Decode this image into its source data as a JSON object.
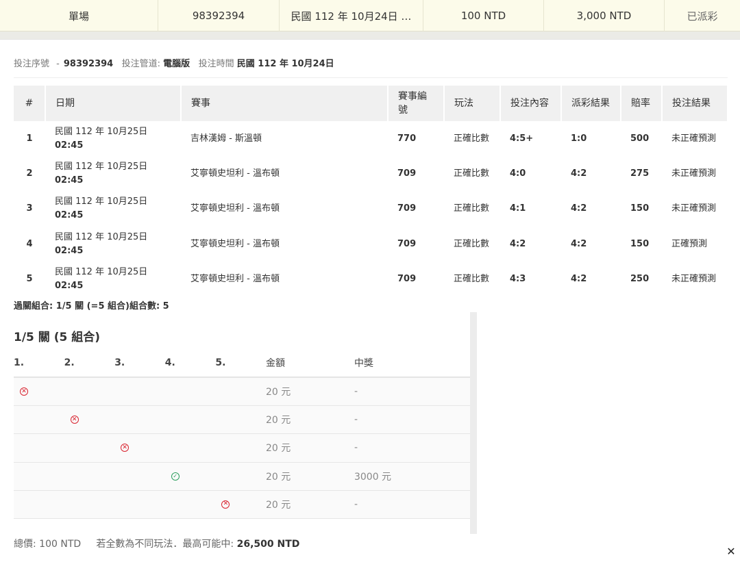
{
  "summary": {
    "type": "單場",
    "bet_no": "98392394",
    "date": "民國 112 年 10月24日 …",
    "stake": "100 NTD",
    "max_win": "3,000 NTD",
    "status": "已派彩"
  },
  "meta": {
    "bet_no_label": "投注序號",
    "bet_no_sep": "-",
    "bet_no": "98392394",
    "channel_label": "投注管道:",
    "channel": "電腦版",
    "time_label": "投注時間",
    "time": "民國 112 年 10月24日"
  },
  "bets": {
    "headers": [
      "#",
      "日期",
      "賽事",
      "賽事編號",
      "玩法",
      "投注內容",
      "派彩結果",
      "賠率",
      "投注結果"
    ],
    "rows": [
      {
        "no": "1",
        "date": "民國 112 年 10月25日",
        "time": "02:45",
        "match": "吉林漢姆 - 斯溫頓",
        "match_no": "770",
        "play": "正確比數",
        "pick": "4:5+",
        "result": "1:0",
        "odds": "500",
        "outcome": "未正確預測"
      },
      {
        "no": "2",
        "date": "民國 112 年 10月25日",
        "time": "02:45",
        "match": "艾寧頓史坦利 - 溫布頓",
        "match_no": "709",
        "play": "正確比數",
        "pick": "4:0",
        "result": "4:2",
        "odds": "275",
        "outcome": "未正確預測"
      },
      {
        "no": "3",
        "date": "民國 112 年 10月25日",
        "time": "02:45",
        "match": "艾寧頓史坦利 - 溫布頓",
        "match_no": "709",
        "play": "正確比數",
        "pick": "4:1",
        "result": "4:2",
        "odds": "150",
        "outcome": "未正確預測"
      },
      {
        "no": "4",
        "date": "民國 112 年 10月25日",
        "time": "02:45",
        "match": "艾寧頓史坦利 - 溫布頓",
        "match_no": "709",
        "play": "正確比數",
        "pick": "4:2",
        "result": "4:2",
        "odds": "150",
        "outcome": "正確預測"
      },
      {
        "no": "5",
        "date": "民國 112 年 10月25日",
        "time": "02:45",
        "match": "艾寧頓史坦利 - 溫布頓",
        "match_no": "709",
        "play": "正確比數",
        "pick": "4:3",
        "result": "4:2",
        "odds": "250",
        "outcome": "未正確預測"
      }
    ]
  },
  "combo_summary": "過關組合: 1/5 關 (=5 組合)組合數: 5",
  "combo": {
    "title": "1/5 關 (5 組合)",
    "headers": [
      "1.",
      "2.",
      "3.",
      "4.",
      "5.",
      "金額",
      "中獎"
    ],
    "rows": [
      {
        "leg": 1,
        "icon": "cross-circle-icon",
        "amount": "20 元",
        "prize": "-"
      },
      {
        "leg": 2,
        "icon": "cross-circle-icon",
        "amount": "20 元",
        "prize": "-"
      },
      {
        "leg": 3,
        "icon": "cross-circle-icon",
        "amount": "20 元",
        "prize": "-"
      },
      {
        "leg": 4,
        "icon": "check-circle-icon",
        "amount": "20 元",
        "prize": "3000 元"
      },
      {
        "leg": 5,
        "icon": "cross-circle-icon",
        "amount": "20 元",
        "prize": "-"
      }
    ],
    "colors": {
      "cross": "#d9232f",
      "check": "#2a9d5c"
    }
  },
  "footer": {
    "total_label": "總價:",
    "total": "100 NTD",
    "note": "若全數為不同玩法．最高可能中:",
    "max": "26,500 NTD"
  },
  "close_label": "✕"
}
